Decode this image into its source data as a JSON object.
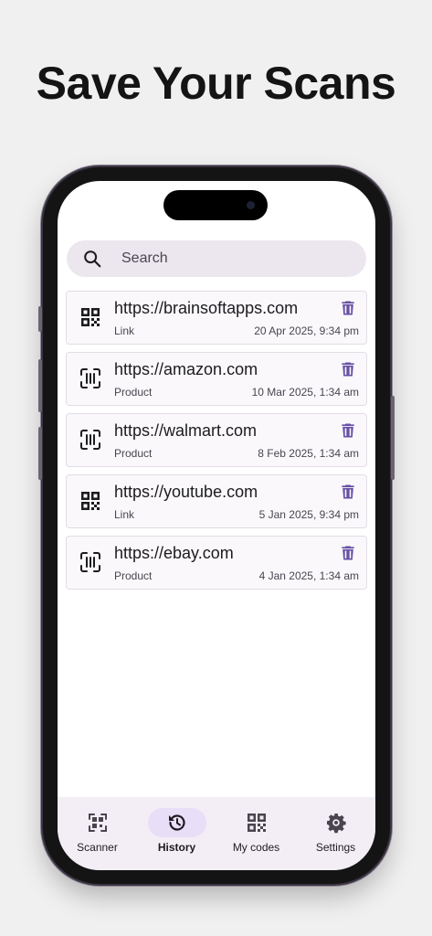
{
  "headline": "Save Your Scans",
  "search": {
    "placeholder": "Search"
  },
  "colors": {
    "accent": "#6750a4",
    "pill": "#e8def8",
    "nav_bg": "#f3eef5"
  },
  "history": [
    {
      "url": "https://brainsoftapps.com",
      "kind": "Link",
      "date": "20 Apr 2025, 9:34 pm",
      "icon": "qr-code-icon"
    },
    {
      "url": "https://amazon.com",
      "kind": "Product",
      "date": "10 Mar 2025, 1:34 am",
      "icon": "barcode-icon"
    },
    {
      "url": "https://walmart.com",
      "kind": "Product",
      "date": "8 Feb 2025, 1:34 am",
      "icon": "barcode-icon"
    },
    {
      "url": "https://youtube.com",
      "kind": "Link",
      "date": "5 Jan 2025, 9:34 pm",
      "icon": "qr-code-icon"
    },
    {
      "url": "https://ebay.com",
      "kind": "Product",
      "date": "4 Jan 2025, 1:34 am",
      "icon": "barcode-icon"
    }
  ],
  "nav": {
    "scanner": "Scanner",
    "history": "History",
    "my_codes": "My codes",
    "settings": "Settings",
    "active": "History"
  }
}
